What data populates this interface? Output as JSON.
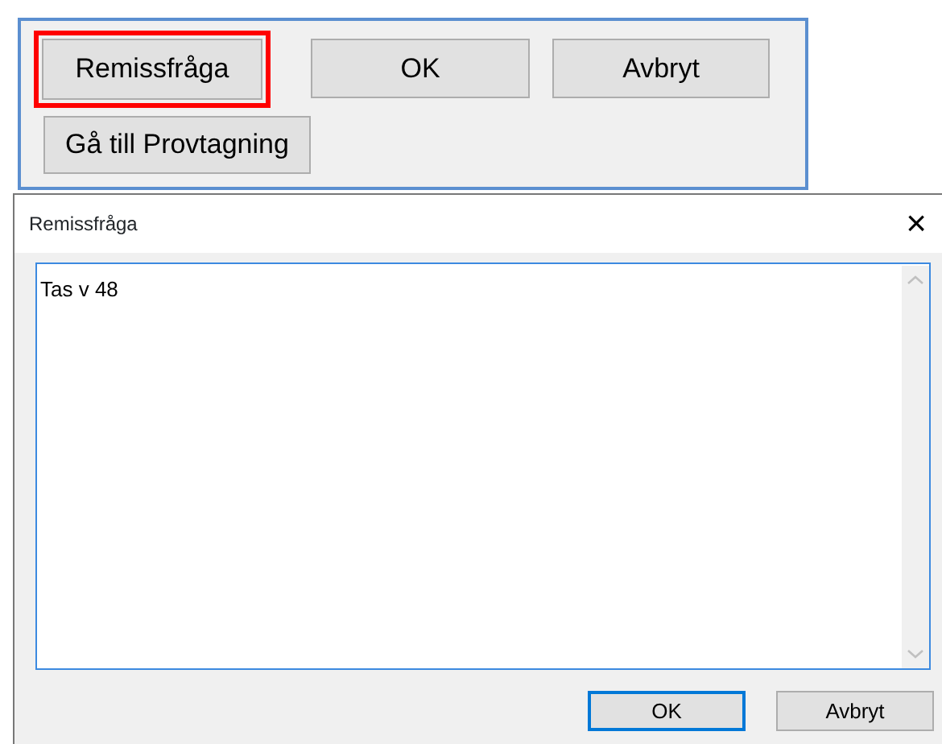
{
  "panel": {
    "buttons": [
      {
        "label": "Remissfråga",
        "highlighted": true
      },
      {
        "label": "OK",
        "highlighted": false
      },
      {
        "label": "Avbryt",
        "highlighted": false
      },
      {
        "label": "Gå till Provtagning",
        "highlighted": false
      }
    ]
  },
  "dialog": {
    "title": "Remissfråga",
    "close": "×",
    "text": "Tas v 48",
    "buttons": [
      {
        "label": "OK",
        "default": true
      },
      {
        "label": "Avbryt",
        "default": false
      }
    ]
  }
}
